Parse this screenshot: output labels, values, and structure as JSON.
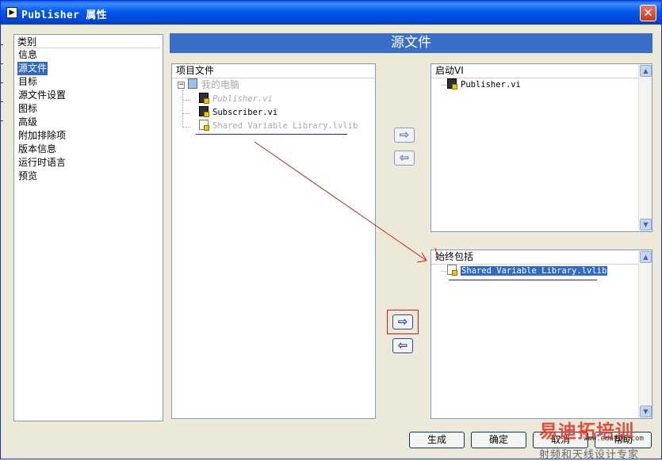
{
  "window": {
    "title": "Publisher 属性",
    "app_icon_glyph": "▶",
    "close_glyph": "✕"
  },
  "sidebar": {
    "header": "类别",
    "items": [
      {
        "label": "信息",
        "selected": false
      },
      {
        "label": "源文件",
        "selected": true
      },
      {
        "label": "目标",
        "selected": false
      },
      {
        "label": "源文件设置",
        "selected": false
      },
      {
        "label": "图标",
        "selected": false
      },
      {
        "label": "高级",
        "selected": false
      },
      {
        "label": "附加排除项",
        "selected": false
      },
      {
        "label": "版本信息",
        "selected": false
      },
      {
        "label": "运行时语言",
        "selected": false
      },
      {
        "label": "预览",
        "selected": false
      }
    ]
  },
  "main": {
    "banner": "源文件",
    "project_files": {
      "header": "项目文件",
      "root": {
        "label": "我的电脑",
        "expander": "−",
        "icon": "computer-icon"
      },
      "files": [
        {
          "label": "Publisher.vi",
          "icon": "vi-file-icon",
          "greyed": true
        },
        {
          "label": "Subscriber.vi",
          "icon": "vi-file-icon",
          "greyed": false
        },
        {
          "label": "Shared Variable Library.lvlib",
          "icon": "library-file-icon",
          "greyed": true
        }
      ]
    },
    "startup_vis": {
      "header": "启动VI",
      "files": [
        {
          "label": "Publisher.vi",
          "icon": "vi-file-icon"
        }
      ]
    },
    "always_included": {
      "header": "始终包括",
      "files": [
        {
          "label": "Shared Variable Library.lvlib",
          "icon": "library-file-icon",
          "selected": true
        }
      ]
    },
    "arrows": {
      "add": "⇨",
      "remove": "⇦"
    },
    "scroll": {
      "up": "▲",
      "down": "▼"
    }
  },
  "buttons": {
    "build": "生成",
    "ok": "确定",
    "cancel": "取消",
    "help": "帮助"
  },
  "watermark": {
    "big": "易迪拓培训",
    "url": "www.edatop.com",
    "small": "射频和天线设计专家"
  },
  "colors": {
    "title_bar": "#0058ee",
    "banner": "#3a6ec9",
    "selection": "#316ac5",
    "annotation": "#d11d1d"
  }
}
